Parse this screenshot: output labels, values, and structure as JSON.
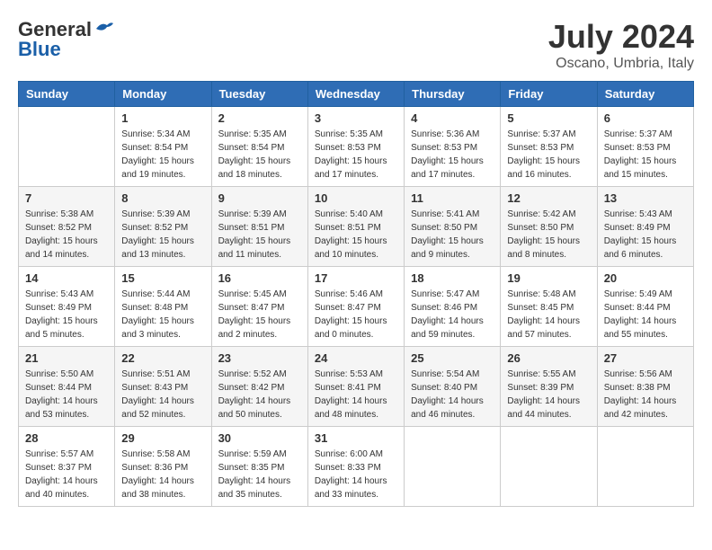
{
  "header": {
    "logo_general": "General",
    "logo_blue": "Blue",
    "month_title": "July 2024",
    "location": "Oscano, Umbria, Italy"
  },
  "weekdays": [
    "Sunday",
    "Monday",
    "Tuesday",
    "Wednesday",
    "Thursday",
    "Friday",
    "Saturday"
  ],
  "weeks": [
    [
      {
        "day": null,
        "info": null
      },
      {
        "day": "1",
        "sunrise": "Sunrise: 5:34 AM",
        "sunset": "Sunset: 8:54 PM",
        "daylight": "Daylight: 15 hours and 19 minutes."
      },
      {
        "day": "2",
        "sunrise": "Sunrise: 5:35 AM",
        "sunset": "Sunset: 8:54 PM",
        "daylight": "Daylight: 15 hours and 18 minutes."
      },
      {
        "day": "3",
        "sunrise": "Sunrise: 5:35 AM",
        "sunset": "Sunset: 8:53 PM",
        "daylight": "Daylight: 15 hours and 17 minutes."
      },
      {
        "day": "4",
        "sunrise": "Sunrise: 5:36 AM",
        "sunset": "Sunset: 8:53 PM",
        "daylight": "Daylight: 15 hours and 17 minutes."
      },
      {
        "day": "5",
        "sunrise": "Sunrise: 5:37 AM",
        "sunset": "Sunset: 8:53 PM",
        "daylight": "Daylight: 15 hours and 16 minutes."
      },
      {
        "day": "6",
        "sunrise": "Sunrise: 5:37 AM",
        "sunset": "Sunset: 8:53 PM",
        "daylight": "Daylight: 15 hours and 15 minutes."
      }
    ],
    [
      {
        "day": "7",
        "sunrise": "Sunrise: 5:38 AM",
        "sunset": "Sunset: 8:52 PM",
        "daylight": "Daylight: 15 hours and 14 minutes."
      },
      {
        "day": "8",
        "sunrise": "Sunrise: 5:39 AM",
        "sunset": "Sunset: 8:52 PM",
        "daylight": "Daylight: 15 hours and 13 minutes."
      },
      {
        "day": "9",
        "sunrise": "Sunrise: 5:39 AM",
        "sunset": "Sunset: 8:51 PM",
        "daylight": "Daylight: 15 hours and 11 minutes."
      },
      {
        "day": "10",
        "sunrise": "Sunrise: 5:40 AM",
        "sunset": "Sunset: 8:51 PM",
        "daylight": "Daylight: 15 hours and 10 minutes."
      },
      {
        "day": "11",
        "sunrise": "Sunrise: 5:41 AM",
        "sunset": "Sunset: 8:50 PM",
        "daylight": "Daylight: 15 hours and 9 minutes."
      },
      {
        "day": "12",
        "sunrise": "Sunrise: 5:42 AM",
        "sunset": "Sunset: 8:50 PM",
        "daylight": "Daylight: 15 hours and 8 minutes."
      },
      {
        "day": "13",
        "sunrise": "Sunrise: 5:43 AM",
        "sunset": "Sunset: 8:49 PM",
        "daylight": "Daylight: 15 hours and 6 minutes."
      }
    ],
    [
      {
        "day": "14",
        "sunrise": "Sunrise: 5:43 AM",
        "sunset": "Sunset: 8:49 PM",
        "daylight": "Daylight: 15 hours and 5 minutes."
      },
      {
        "day": "15",
        "sunrise": "Sunrise: 5:44 AM",
        "sunset": "Sunset: 8:48 PM",
        "daylight": "Daylight: 15 hours and 3 minutes."
      },
      {
        "day": "16",
        "sunrise": "Sunrise: 5:45 AM",
        "sunset": "Sunset: 8:47 PM",
        "daylight": "Daylight: 15 hours and 2 minutes."
      },
      {
        "day": "17",
        "sunrise": "Sunrise: 5:46 AM",
        "sunset": "Sunset: 8:47 PM",
        "daylight": "Daylight: 15 hours and 0 minutes."
      },
      {
        "day": "18",
        "sunrise": "Sunrise: 5:47 AM",
        "sunset": "Sunset: 8:46 PM",
        "daylight": "Daylight: 14 hours and 59 minutes."
      },
      {
        "day": "19",
        "sunrise": "Sunrise: 5:48 AM",
        "sunset": "Sunset: 8:45 PM",
        "daylight": "Daylight: 14 hours and 57 minutes."
      },
      {
        "day": "20",
        "sunrise": "Sunrise: 5:49 AM",
        "sunset": "Sunset: 8:44 PM",
        "daylight": "Daylight: 14 hours and 55 minutes."
      }
    ],
    [
      {
        "day": "21",
        "sunrise": "Sunrise: 5:50 AM",
        "sunset": "Sunset: 8:44 PM",
        "daylight": "Daylight: 14 hours and 53 minutes."
      },
      {
        "day": "22",
        "sunrise": "Sunrise: 5:51 AM",
        "sunset": "Sunset: 8:43 PM",
        "daylight": "Daylight: 14 hours and 52 minutes."
      },
      {
        "day": "23",
        "sunrise": "Sunrise: 5:52 AM",
        "sunset": "Sunset: 8:42 PM",
        "daylight": "Daylight: 14 hours and 50 minutes."
      },
      {
        "day": "24",
        "sunrise": "Sunrise: 5:53 AM",
        "sunset": "Sunset: 8:41 PM",
        "daylight": "Daylight: 14 hours and 48 minutes."
      },
      {
        "day": "25",
        "sunrise": "Sunrise: 5:54 AM",
        "sunset": "Sunset: 8:40 PM",
        "daylight": "Daylight: 14 hours and 46 minutes."
      },
      {
        "day": "26",
        "sunrise": "Sunrise: 5:55 AM",
        "sunset": "Sunset: 8:39 PM",
        "daylight": "Daylight: 14 hours and 44 minutes."
      },
      {
        "day": "27",
        "sunrise": "Sunrise: 5:56 AM",
        "sunset": "Sunset: 8:38 PM",
        "daylight": "Daylight: 14 hours and 42 minutes."
      }
    ],
    [
      {
        "day": "28",
        "sunrise": "Sunrise: 5:57 AM",
        "sunset": "Sunset: 8:37 PM",
        "daylight": "Daylight: 14 hours and 40 minutes."
      },
      {
        "day": "29",
        "sunrise": "Sunrise: 5:58 AM",
        "sunset": "Sunset: 8:36 PM",
        "daylight": "Daylight: 14 hours and 38 minutes."
      },
      {
        "day": "30",
        "sunrise": "Sunrise: 5:59 AM",
        "sunset": "Sunset: 8:35 PM",
        "daylight": "Daylight: 14 hours and 35 minutes."
      },
      {
        "day": "31",
        "sunrise": "Sunrise: 6:00 AM",
        "sunset": "Sunset: 8:33 PM",
        "daylight": "Daylight: 14 hours and 33 minutes."
      },
      {
        "day": null,
        "info": null
      },
      {
        "day": null,
        "info": null
      },
      {
        "day": null,
        "info": null
      }
    ]
  ]
}
